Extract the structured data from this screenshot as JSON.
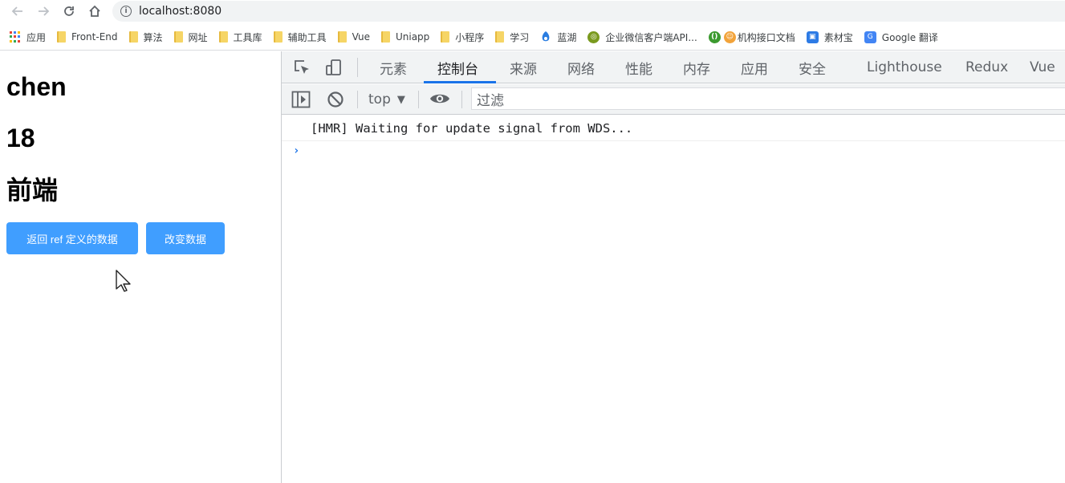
{
  "browser": {
    "url": "localhost:8080",
    "nav": {
      "back_icon": "arrow-left-icon",
      "forward_icon": "arrow-right-icon",
      "reload_icon": "reload-icon",
      "home_icon": "home-icon",
      "info_icon": "info-icon"
    }
  },
  "bookmarks": {
    "apps_label": "应用",
    "items": [
      {
        "label": "Front-End",
        "icon": "folder-icon"
      },
      {
        "label": "算法",
        "icon": "folder-icon"
      },
      {
        "label": "网址",
        "icon": "folder-icon"
      },
      {
        "label": "工具库",
        "icon": "folder-icon"
      },
      {
        "label": "辅助工具",
        "icon": "folder-icon"
      },
      {
        "label": "Vue",
        "icon": "folder-icon"
      },
      {
        "label": "Uniapp",
        "icon": "folder-icon"
      },
      {
        "label": "小程序",
        "icon": "folder-icon"
      },
      {
        "label": "学习",
        "icon": "folder-icon"
      },
      {
        "label": "蓝湖",
        "icon": "lanhu-icon"
      },
      {
        "label": "企业微信客户端API...",
        "icon": "wework-icon"
      },
      {
        "label": "机构接口文档",
        "icon": "api-doc-icon"
      },
      {
        "label": "素材宝",
        "icon": "sucaibao-icon"
      },
      {
        "label": "Google 翻译",
        "icon": "google-translate-icon"
      }
    ]
  },
  "page": {
    "name": "chen",
    "age": "18",
    "job": "前端",
    "buttons": {
      "return_ref": "返回 ref 定义的数据",
      "change_data": "改变数据"
    },
    "accent_color": "#409eff"
  },
  "devtools": {
    "tabs": [
      "元素",
      "控制台",
      "来源",
      "网络",
      "性能",
      "内存",
      "应用",
      "安全",
      "Lighthouse",
      "Redux",
      "Vue"
    ],
    "active_tab": "控制台",
    "context": "top",
    "filter_placeholder": "过滤",
    "logs": [
      "[HMR] Waiting for update signal from WDS..."
    ],
    "prompt": "›"
  }
}
